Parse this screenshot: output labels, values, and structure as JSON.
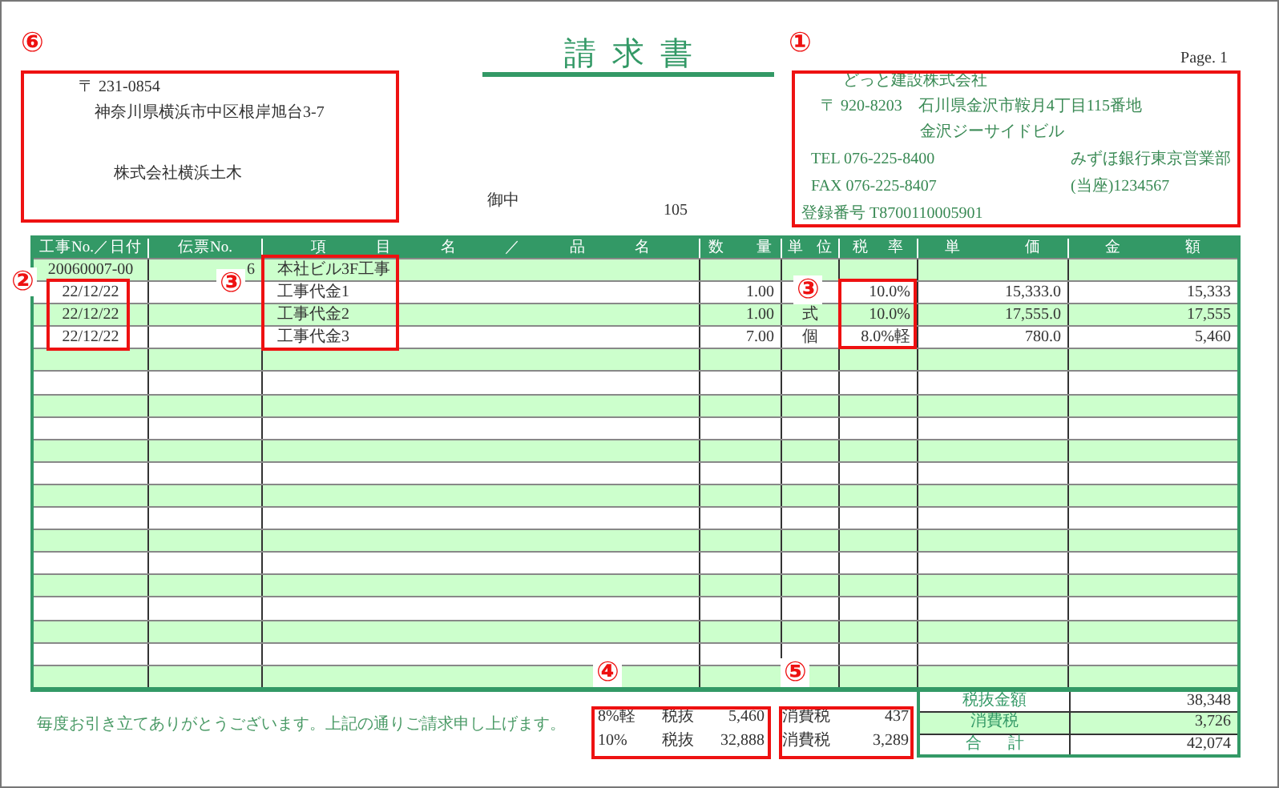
{
  "title": "請求書",
  "page": "Page. 1",
  "recipient": {
    "postal": "〒 231-0854",
    "address": "神奈川県横浜市中区根岸旭台3-7",
    "name": "株式会社横浜土木",
    "honorific": "御中",
    "code": "105"
  },
  "issuer": {
    "company": "どっと建設株式会社",
    "postal": "〒 920-8203",
    "address": "石川県金沢市鞍月4丁目115番地",
    "building": "金沢ジーサイドビル",
    "tel": "TEL 076-225-8400",
    "fax": "FAX 076-225-8407",
    "bank": "みずほ銀行東京営業部",
    "account": "(当座)1234567",
    "registration": "登録番号 T8700110005901"
  },
  "table": {
    "columns": [
      "工事No.／日付",
      "伝票No.",
      "項 目 名 ／ 品 名",
      "数 量",
      "単 位",
      "税 率",
      "単 価",
      "金 額"
    ],
    "rows": [
      {
        "no_date": "20060007-00",
        "slip_no": "6",
        "item": "本社ビル3F工事"
      },
      {
        "no_date": "22/12/22",
        "item": "工事代金1",
        "quantity": "1.00",
        "tax_rate": "10.0%",
        "unit_price": "15,333.0",
        "amount": "15,333"
      },
      {
        "no_date": "22/12/22",
        "item": "工事代金2",
        "quantity": "1.00",
        "unit": "式",
        "tax_rate": "10.0%",
        "unit_price": "17,555.0",
        "amount": "17,555"
      },
      {
        "no_date": "22/12/22",
        "item": "工事代金3",
        "quantity": "7.00",
        "unit": "個",
        "tax_rate": "8.0%軽",
        "unit_price": "780.0",
        "amount": "5,460"
      }
    ]
  },
  "message": "毎度お引き立てありがとうございます。上記の通りご請求申し上げます。",
  "tax_breakdown": [
    {
      "rate": "8%軽",
      "base_label": "税抜",
      "base": "5,460",
      "tax_label": "消費税",
      "tax": "437"
    },
    {
      "rate": "10%",
      "base_label": "税抜",
      "base": "32,888",
      "tax_label": "消費税",
      "tax": "3,289"
    }
  ],
  "summary": [
    {
      "label": "税抜金額",
      "value": "38,348"
    },
    {
      "label": "消費税",
      "value": "3,726"
    },
    {
      "label": "合 計",
      "value": "42,074"
    }
  ],
  "annotations": [
    "⑥",
    "①",
    "②",
    "③",
    "③",
    "④",
    "⑤"
  ]
}
